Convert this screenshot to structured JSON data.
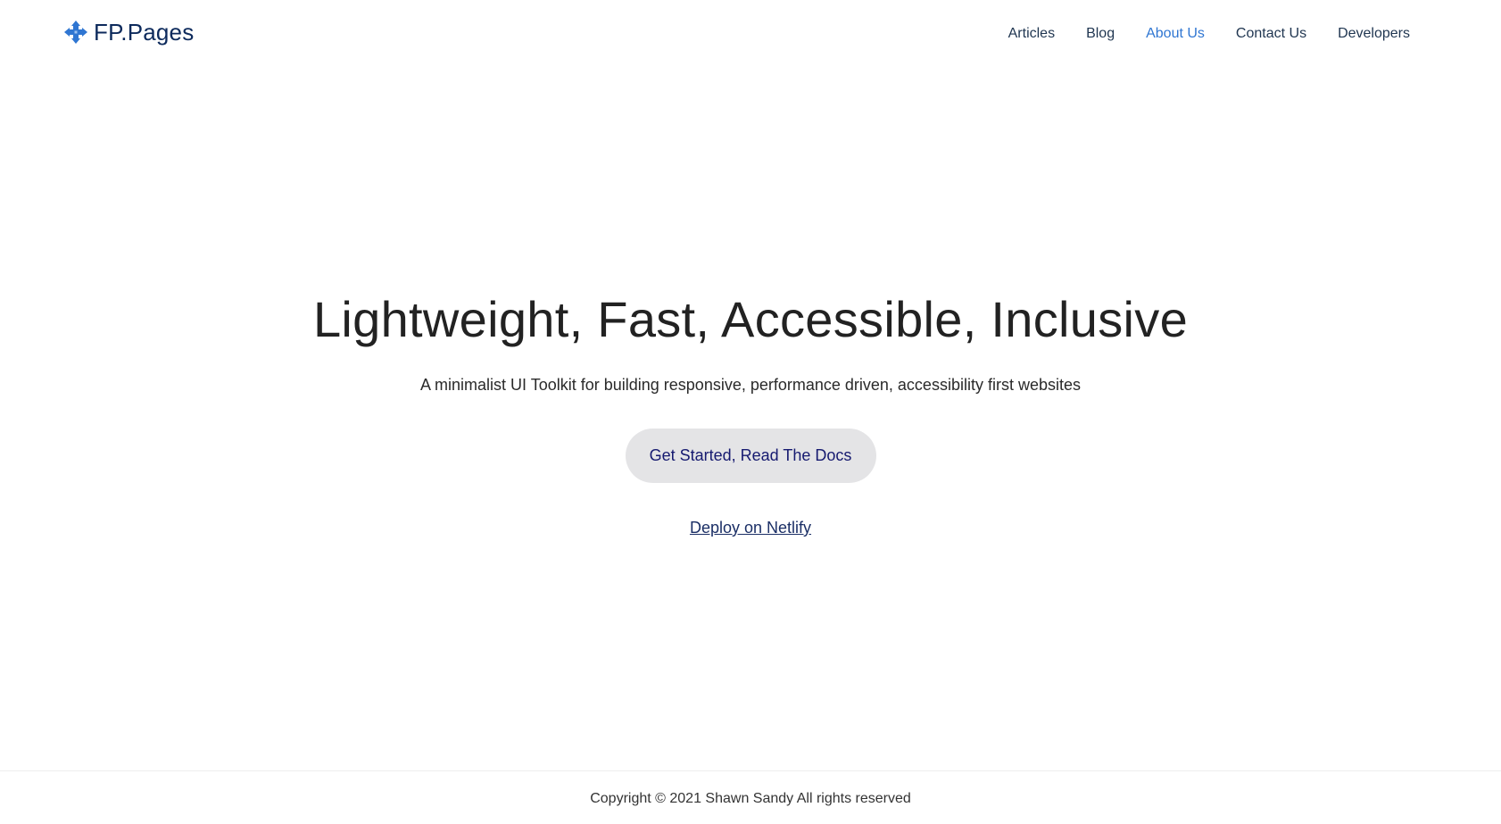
{
  "header": {
    "brand": {
      "name": "FP.Pages",
      "icon": "four-arrows-move-icon",
      "color": "#0d2a5c",
      "icon_color": "#2f76d2"
    },
    "nav": [
      {
        "label": "Articles",
        "active": false
      },
      {
        "label": "Blog",
        "active": false
      },
      {
        "label": "About Us",
        "active": true
      },
      {
        "label": "Contact Us",
        "active": false
      },
      {
        "label": "Developers",
        "active": false
      }
    ],
    "active_color": "#2f76d2"
  },
  "hero": {
    "title": "Lightweight, Fast, Accessible, Inclusive",
    "subtitle": "A minimalist UI Toolkit for building responsive, performance driven, accessibility first websites",
    "cta_label": "Get Started, Read The Docs",
    "secondary_link": "Deploy on Netlify"
  },
  "footer": {
    "copyright": "Copyright © 2021 Shawn Sandy All rights reserved"
  }
}
